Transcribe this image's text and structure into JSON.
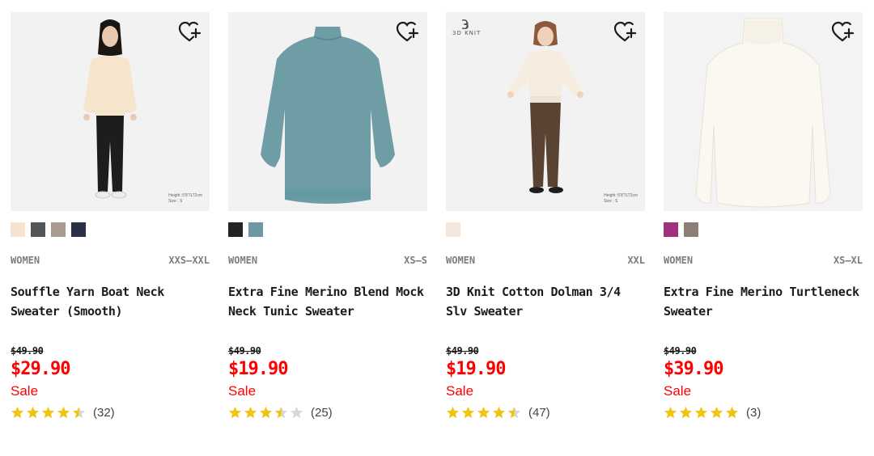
{
  "colors": {
    "sale": "#ff0000",
    "star": "#f1c40f",
    "star_empty": "#d7d7d7"
  },
  "products": [
    {
      "category": "WOMEN",
      "sizes": "XXS–XXL",
      "name": "Souffle Yarn Boat Neck Sweater (Smooth)",
      "price_original": "$49.90",
      "price_sale": "$29.90",
      "sale_label": "Sale",
      "rating": 4.5,
      "review_count": "(32)",
      "image": "woman-in-cream-sweater-and-black-pants",
      "model_height": "Height :5'8\"/172cm",
      "model_size": "Size : S",
      "swatches": [
        "#f5e3cf",
        "#525659",
        "#a89a90",
        "#2a3045"
      ]
    },
    {
      "category": "WOMEN",
      "sizes": "XS–S",
      "name": "Extra Fine Merino Blend Mock Neck Tunic Sweater",
      "price_original": "$49.90",
      "price_sale": "$19.90",
      "sale_label": "Sale",
      "rating": 3.5,
      "review_count": "(25)",
      "image": "teal-tunic-sweater-flat",
      "swatches": [
        "#232323",
        "#6b98a2"
      ]
    },
    {
      "category": "WOMEN",
      "sizes": "XXL",
      "name": "3D Knit Cotton Dolman 3/4 Slv Sweater",
      "price_original": "$49.90",
      "price_sale": "$19.90",
      "sale_label": "Sale",
      "rating": 4.5,
      "review_count": "(47)",
      "image": "woman-in-cream-dolman-sweater-and-brown-pants",
      "badge": "3D KNIT",
      "model_height": "Height :5'8\"/172cm",
      "model_size": "Size : S",
      "swatches": [
        "#f5e7dc"
      ]
    },
    {
      "category": "WOMEN",
      "sizes": "XS–XL",
      "name": "Extra Fine Merino Turtleneck Sweater",
      "price_original": "$49.90",
      "price_sale": "$39.90",
      "sale_label": "Sale",
      "rating": 5,
      "review_count": "(3)",
      "image": "cream-turtleneck-sweater-flat",
      "swatches": [
        "#a0307e",
        "#8c7f79"
      ]
    }
  ]
}
